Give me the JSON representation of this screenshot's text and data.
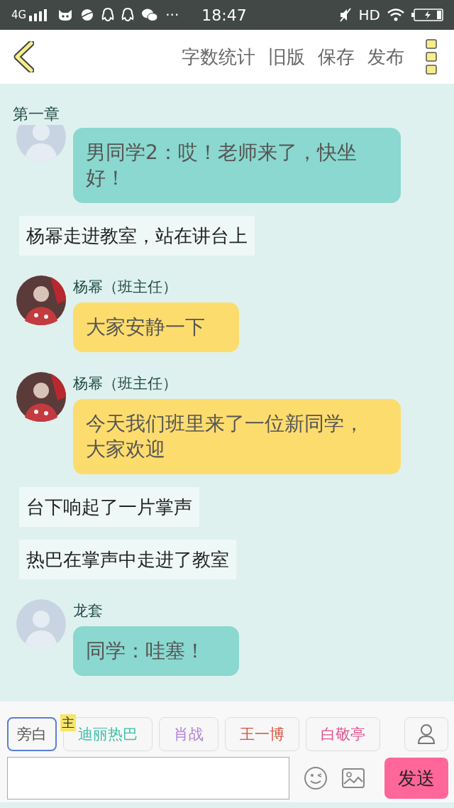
{
  "status_bar": {
    "network": "4G",
    "dots": "···",
    "time": "18:47",
    "hd": "HD"
  },
  "toolbar": {
    "actions": [
      "字数统计",
      "旧版",
      "保存",
      "发布"
    ]
  },
  "chapter_title": "第一章",
  "messages": [
    {
      "kind": "chat",
      "avatar": {
        "kind": "default"
      },
      "color": "#8ad8cf",
      "text": "男同学2：哎！老师来了，快坐好！"
    },
    {
      "kind": "narration",
      "text": "杨幂走进教室，站在讲台上"
    },
    {
      "kind": "chat",
      "name": "杨幂（班主任）",
      "color": "#fddc6e",
      "text": "大家安静一下"
    },
    {
      "kind": "chat",
      "name": "杨幂（班主任）",
      "color": "#fddc6e",
      "text": "今天我们班里来了一位新同学，大家欢迎"
    },
    {
      "kind": "narration",
      "text": "台下响起了一片掌声"
    },
    {
      "kind": "narration",
      "text": "热巴在掌声中走进了教室"
    },
    {
      "kind": "chat",
      "avatar": {
        "kind": "default"
      },
      "name": "龙套",
      "color": "#8ad8cf",
      "text": "同学：哇塞！"
    }
  ],
  "characters": [
    {
      "label": "旁白",
      "color": "#555555",
      "selected": true
    },
    {
      "label": "迪丽热巴",
      "color": "#3cbfa8",
      "selected": false,
      "badge": "主"
    },
    {
      "label": "肖战",
      "color": "#b37fd6",
      "selected": false
    },
    {
      "label": "王一博",
      "color": "#d9533f",
      "selected": false
    },
    {
      "label": "白敬亭",
      "color": "#e0508f",
      "selected": false
    }
  ],
  "composer": {
    "send": "发送"
  }
}
